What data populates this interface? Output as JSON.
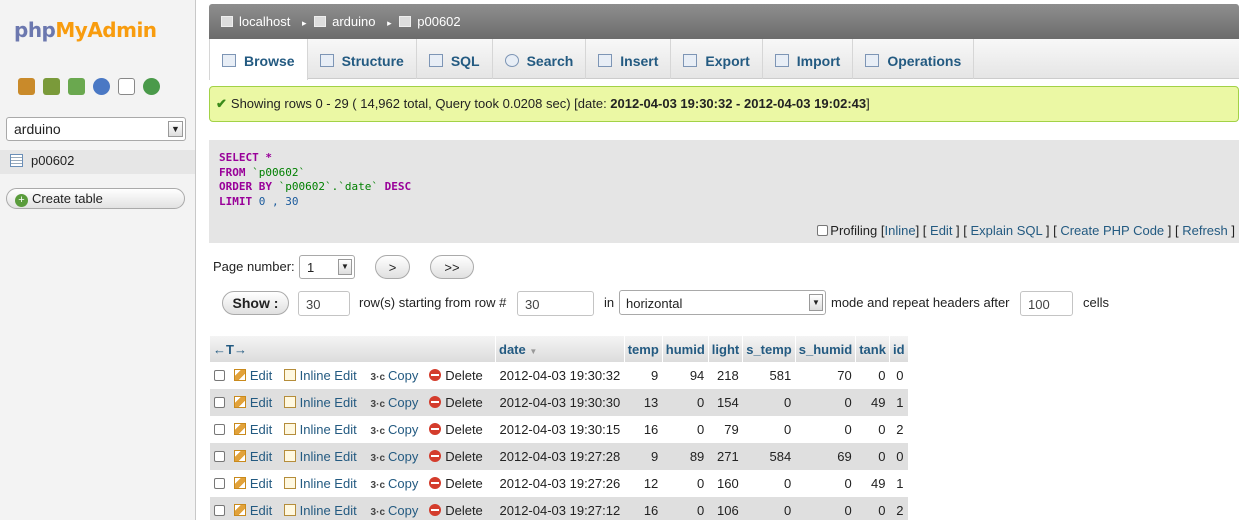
{
  "logo": {
    "php": "php",
    "myadmin": "MyAdmin"
  },
  "sidebar": {
    "database_selected": "arduino",
    "table_item": "p00602",
    "create_table_label": "Create table"
  },
  "breadcrumb": {
    "server": "localhost",
    "database": "arduino",
    "table": "p00602"
  },
  "tabs": [
    {
      "label": "Browse",
      "active": true
    },
    {
      "label": "Structure"
    },
    {
      "label": "SQL"
    },
    {
      "label": "Search"
    },
    {
      "label": "Insert"
    },
    {
      "label": "Export"
    },
    {
      "label": "Import"
    },
    {
      "label": "Operations"
    }
  ],
  "message": {
    "prefix": "Showing rows 0 - 29 ( 14,962 total, Query took 0.0208 sec) [date: ",
    "range": "2012-04-03 19:30:32 - 2012-04-03 19:02:43",
    "suffix": "]"
  },
  "sql": {
    "select_kw": "SELECT",
    "select_rest": " *",
    "from_kw": "FROM",
    "from_table": " `p00602`",
    "orderby_kw": "ORDER BY",
    "orderby_col": " `p00602`.`date`",
    "orderby_dir": " DESC",
    "limit_kw": "LIMIT",
    "limit_val": " 0 , 30"
  },
  "sql_links": {
    "profiling": "Profiling",
    "inline": "Inline",
    "edit": "Edit",
    "explain": "Explain SQL",
    "php_code": "Create PHP Code",
    "refresh": "Refresh"
  },
  "nav": {
    "page_number_label": "Page number:",
    "page_number_value": "1",
    "next_label": ">",
    "last_label": ">>",
    "show_label": "Show :",
    "rows_value": "30",
    "rows_label": "row(s) starting from row #",
    "start_value": "30",
    "in_label": "in",
    "mode_value": "horizontal",
    "mode_label": "mode and repeat headers after",
    "headers_value": "100",
    "cells_label": "cells"
  },
  "table": {
    "arrows": "←T→",
    "columns": [
      "date",
      "temp",
      "humid",
      "light",
      "s_temp",
      "s_humid",
      "tank",
      "id"
    ],
    "actions": {
      "edit": "Edit",
      "inline_edit": "Inline Edit",
      "copy": "Copy",
      "delete": "Delete"
    },
    "rows": [
      [
        "2012-04-03 19:30:32",
        "9",
        "94",
        "218",
        "581",
        "70",
        "0",
        "0"
      ],
      [
        "2012-04-03 19:30:30",
        "13",
        "0",
        "154",
        "0",
        "0",
        "49",
        "1"
      ],
      [
        "2012-04-03 19:30:15",
        "16",
        "0",
        "79",
        "0",
        "0",
        "0",
        "2"
      ],
      [
        "2012-04-03 19:27:28",
        "9",
        "89",
        "271",
        "584",
        "69",
        "0",
        "0"
      ],
      [
        "2012-04-03 19:27:26",
        "12",
        "0",
        "160",
        "0",
        "0",
        "49",
        "1"
      ],
      [
        "2012-04-03 19:27:12",
        "16",
        "0",
        "106",
        "0",
        "0",
        "0",
        "2"
      ]
    ]
  }
}
